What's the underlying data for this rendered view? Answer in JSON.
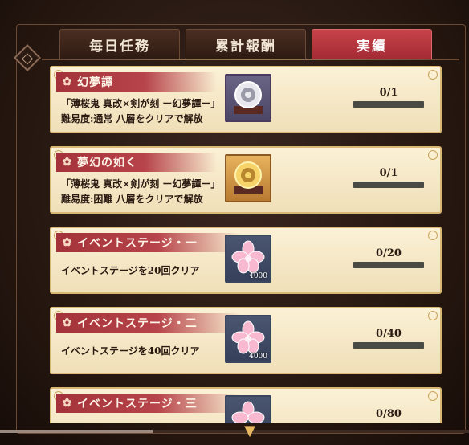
{
  "tabs": [
    {
      "label": "毎日任務"
    },
    {
      "label": "累計報酬"
    },
    {
      "label": "実績"
    }
  ],
  "missions": [
    {
      "title": "幻夢譚",
      "description": "「薄桜鬼 真改×剣が刻 ー幻夢譚ー」難易度:通常 八層をクリアで解放",
      "progress": "0/1",
      "progress_fraction": 0,
      "icon": "silver-crest-icon"
    },
    {
      "title": "夢幻の如く",
      "description": "「薄桜鬼 真改×剣が刻 ー幻夢譚ー」難易度:困難 八層をクリアで解放",
      "progress": "0/1",
      "progress_fraction": 0,
      "icon": "gold-crest-icon"
    },
    {
      "title": "イベントステージ・一",
      "description": "イベントステージを20回クリア",
      "progress": "0/20",
      "progress_fraction": 0,
      "icon": "sakura-icon",
      "amount": "4000"
    },
    {
      "title": "イベントステージ・二",
      "description": "イベントステージを40回クリア",
      "progress": "0/40",
      "progress_fraction": 0,
      "icon": "sakura-icon",
      "amount": "4000"
    },
    {
      "title": "イベントステージ・三",
      "description": "",
      "progress": "0/80",
      "progress_fraction": 0,
      "icon": "sakura-icon"
    }
  ],
  "colors": {
    "active_tab": "#c8434a",
    "ribbon": "#a3323a",
    "card": "#fbf1d6"
  }
}
